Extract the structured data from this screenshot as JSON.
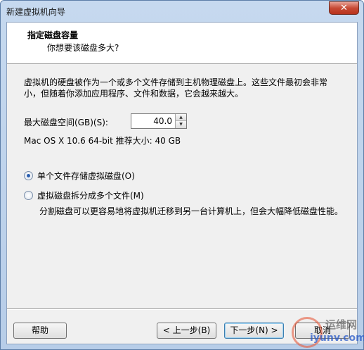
{
  "window": {
    "title": "新建虚拟机向导",
    "close_label": "✕"
  },
  "header": {
    "title": "指定磁盘容量",
    "subtitle": "你想要该磁盘多大?"
  },
  "description": "虚拟机的硬盘被作为一个或多个文件存储到主机物理磁盘上。这些文件最初会非常小，但随着你添加应用程序、文件和数据，它会越来越大。",
  "disk": {
    "size_label": "最大磁盘空间(GB)(S):",
    "size_value": "40.0",
    "recommendation": "Mac OS X 10.6 64-bit 推荐大小: 40 GB"
  },
  "options": {
    "single": {
      "label": "单个文件存储虚拟磁盘(O)",
      "selected": true
    },
    "split": {
      "label": "虚拟磁盘拆分成多个文件(M)",
      "selected": false
    },
    "split_note": "分割磁盘可以更容易地将虚拟机迁移到另一台计算机上，但会大幅降低磁盘性能。"
  },
  "buttons": {
    "help": "帮助",
    "back": "< 上一步(B)",
    "next": "下一步(N) >",
    "cancel": "取消"
  },
  "watermark": {
    "name": "运维网",
    "url": "iyunv.com"
  }
}
